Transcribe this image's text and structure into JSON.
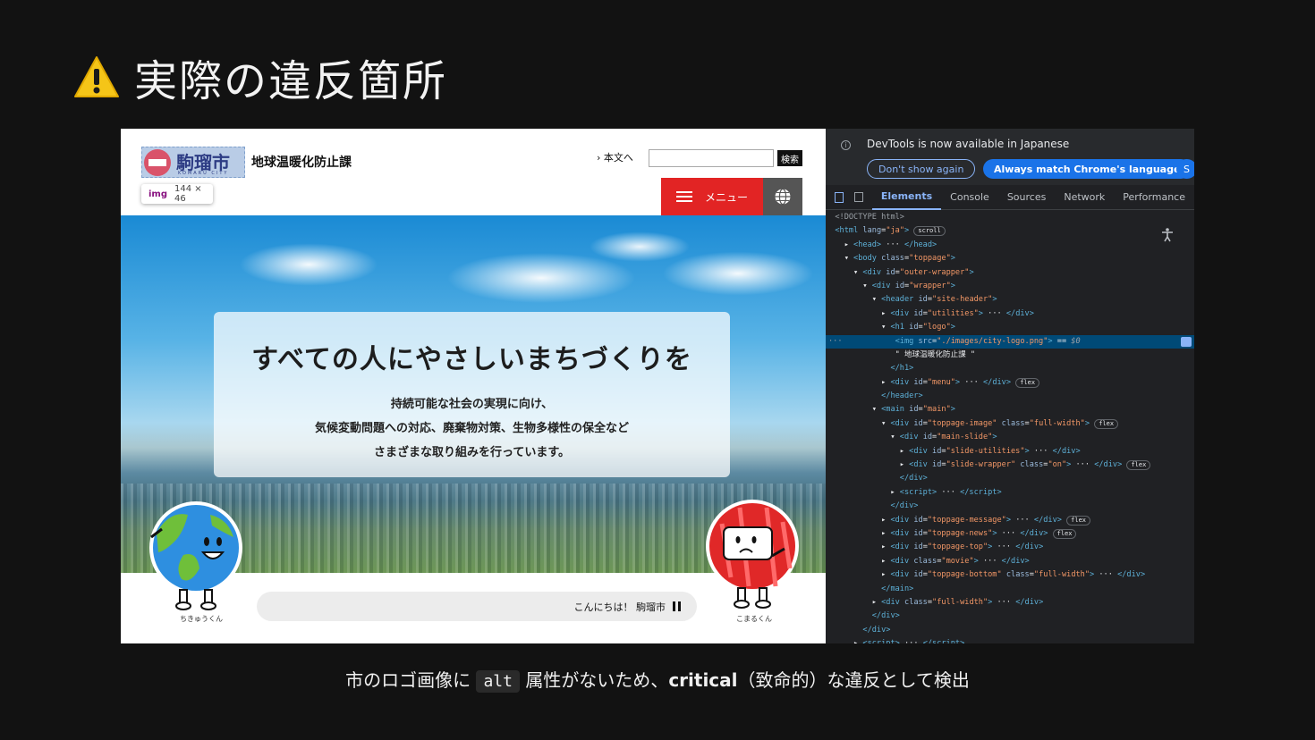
{
  "slide": {
    "title": "実際の違反箇所",
    "caption_before": "市のロゴ画像に",
    "caption_code": "alt",
    "caption_after_pre": "属性がないため、",
    "caption_bold": "critical",
    "caption_after": "（致命的）な違反として検出"
  },
  "site": {
    "logo_text": "駒瑠市",
    "logo_roman": "KOMARU CITY",
    "department": "地球温暖化防止課",
    "tooltip_tag": "img",
    "tooltip_dims": "144 × 46",
    "skip_link": "本文へ",
    "search_placeholder": "",
    "search_button": "検索",
    "menu_label": "メニュー",
    "hero_heading": "すべての人にやさしいまちづくりを",
    "hero_lines": [
      "持続可能な社会の実現に向け、",
      "気候変動問題への対応、廃棄物対策、生物多様性の保全など",
      "さまざまな取り組みを行っています。"
    ],
    "greeting": "こんにちは！ 駒瑠市",
    "mascot_left": "ちきゅうくん",
    "mascot_right": "こまるくん"
  },
  "devtools": {
    "notice": "DevTools is now available in Japanese",
    "btn_dismiss": "Don't show again",
    "btn_match": "Always match Chrome's language",
    "btn_third": "S",
    "tabs": [
      "Elements",
      "Console",
      "Sources",
      "Network",
      "Performance"
    ],
    "active_tab": "Elements"
  },
  "colors": {
    "slide_bg": "#121212",
    "menu_red": "#e22424",
    "devtools_bg": "#202124",
    "devtools_selection": "#004a77",
    "devtools_accent": "#8ab4f8"
  }
}
